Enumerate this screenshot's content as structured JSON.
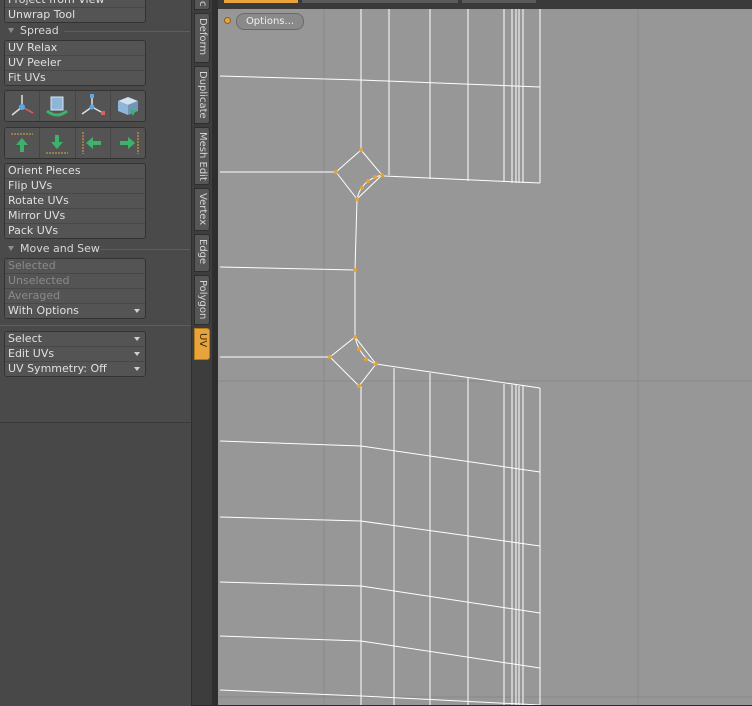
{
  "tool_panel": {
    "top_group": [
      "Project from View",
      "Unwrap Tool"
    ],
    "spread_label": "Spread",
    "spread_group": [
      "UV Relax",
      "UV Peeler",
      "Fit UVs"
    ],
    "icons_row1": [
      "move-pivot-icon",
      "rotate-box-icon",
      "scale-axis-icon",
      "drop-box-icon"
    ],
    "icons_row2": [
      "arrow-up-icon",
      "arrow-down-icon",
      "arrow-left-icon",
      "arrow-right-icon"
    ],
    "orient_group": [
      "Orient Pieces",
      "Flip UVs",
      "Rotate UVs",
      "Mirror UVs",
      "Pack UVs"
    ],
    "move_sew_label": "Move and Sew",
    "move_sew_group": [
      "Selected",
      "Unselected",
      "Averaged"
    ],
    "move_sew_select": "With Options",
    "bottom_group": {
      "select": "Select",
      "edit_uvs": "Edit UVs",
      "uv_symmetry": "UV Symmetry: Off"
    }
  },
  "tabs": [
    "c",
    "Deform",
    "Duplicate",
    "Mesh Edit",
    "Vertex",
    "Edge",
    "Polygon",
    "UV"
  ],
  "active_tab": "UV",
  "viewport": {
    "options_label": "Options..."
  },
  "colors": {
    "accent": "#e8a33a",
    "viewport_bg": "#979797",
    "mesh_line": "#ffffff",
    "panel_bg": "#4a4a4a"
  }
}
